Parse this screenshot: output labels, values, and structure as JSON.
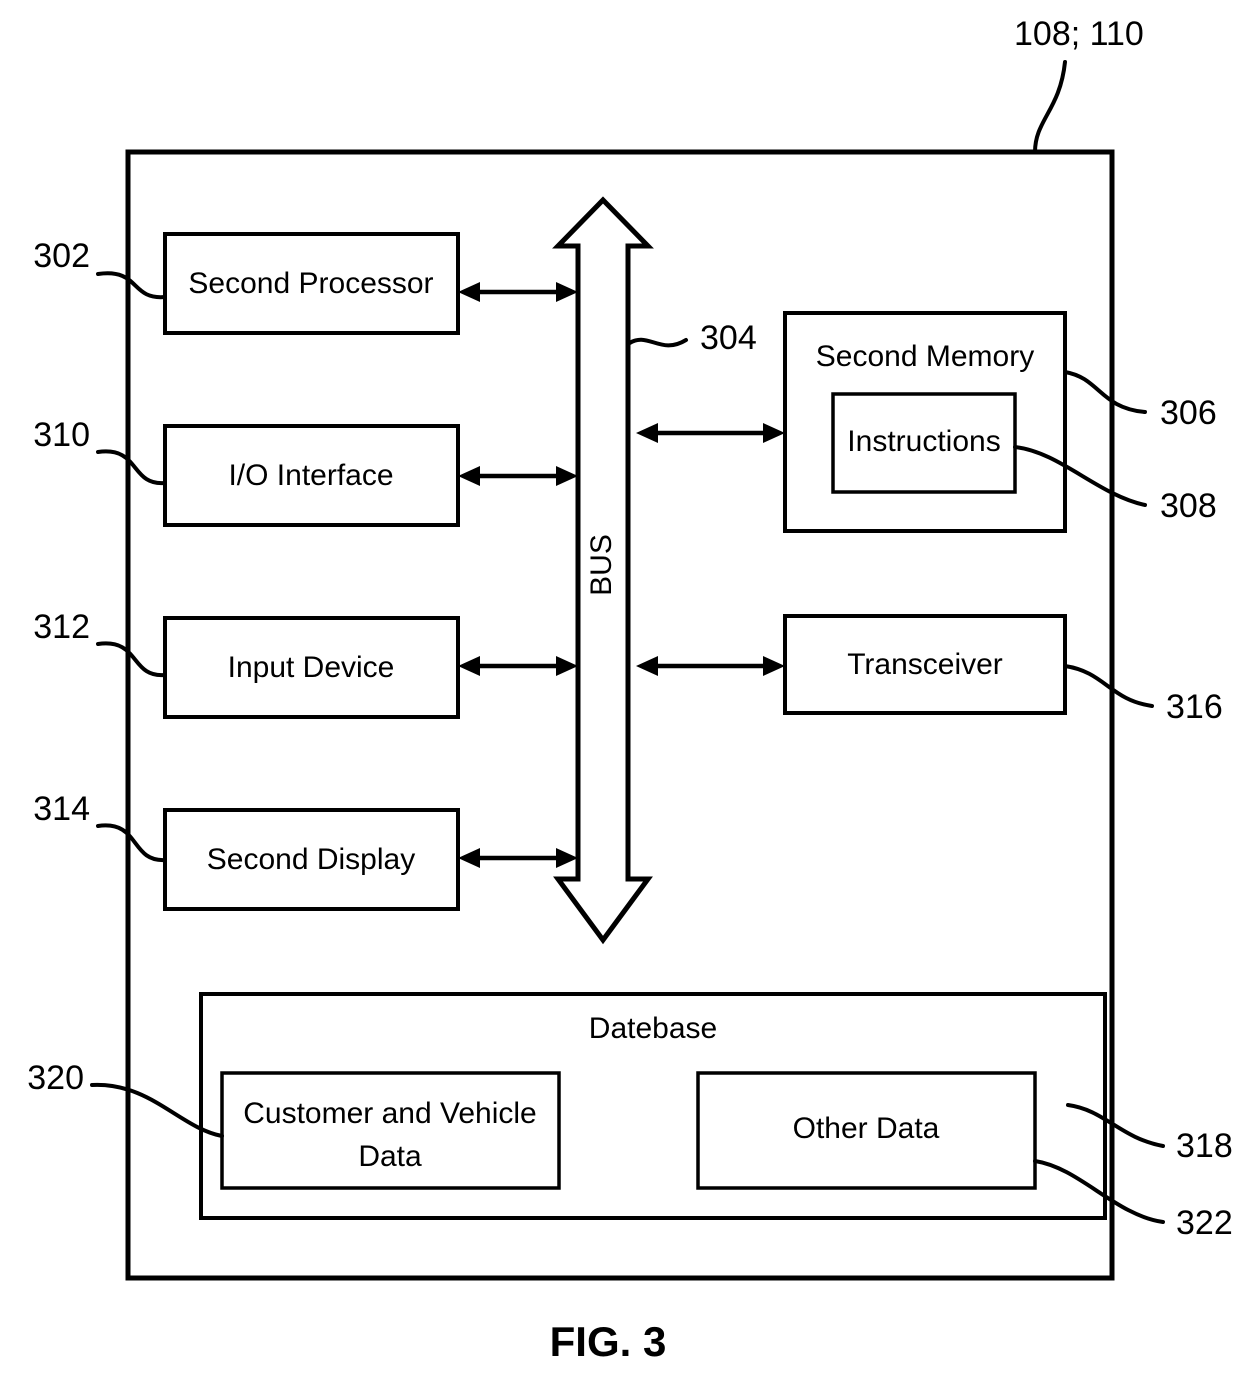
{
  "figure": {
    "caption": "FIG. 3",
    "system_ref": "108; 110",
    "bus_label": "BUS",
    "bus_ref": "304"
  },
  "blocks": [
    {
      "id": "second-processor",
      "label": "Second Processor",
      "ref": "302"
    },
    {
      "id": "io-interface",
      "label": "I/O Interface",
      "ref": "310"
    },
    {
      "id": "input-device",
      "label": "Input Device",
      "ref": "312"
    },
    {
      "id": "second-display",
      "label": "Second Display",
      "ref": "314"
    },
    {
      "id": "second-memory",
      "label": "Second Memory",
      "ref": "306"
    },
    {
      "id": "instructions",
      "label": "Instructions",
      "ref": "308"
    },
    {
      "id": "transceiver",
      "label": "Transceiver",
      "ref": "316"
    },
    {
      "id": "datebase",
      "label": "Datebase",
      "ref": "318"
    },
    {
      "id": "customer-and-vehicle-data",
      "label_line1": "Customer and Vehicle",
      "label_line2": "Data",
      "ref": "320"
    },
    {
      "id": "other-data",
      "label": "Other Data",
      "ref": "322"
    }
  ],
  "colors": {
    "stroke": "#000000",
    "background": "#ffffff",
    "text": "#000000"
  }
}
